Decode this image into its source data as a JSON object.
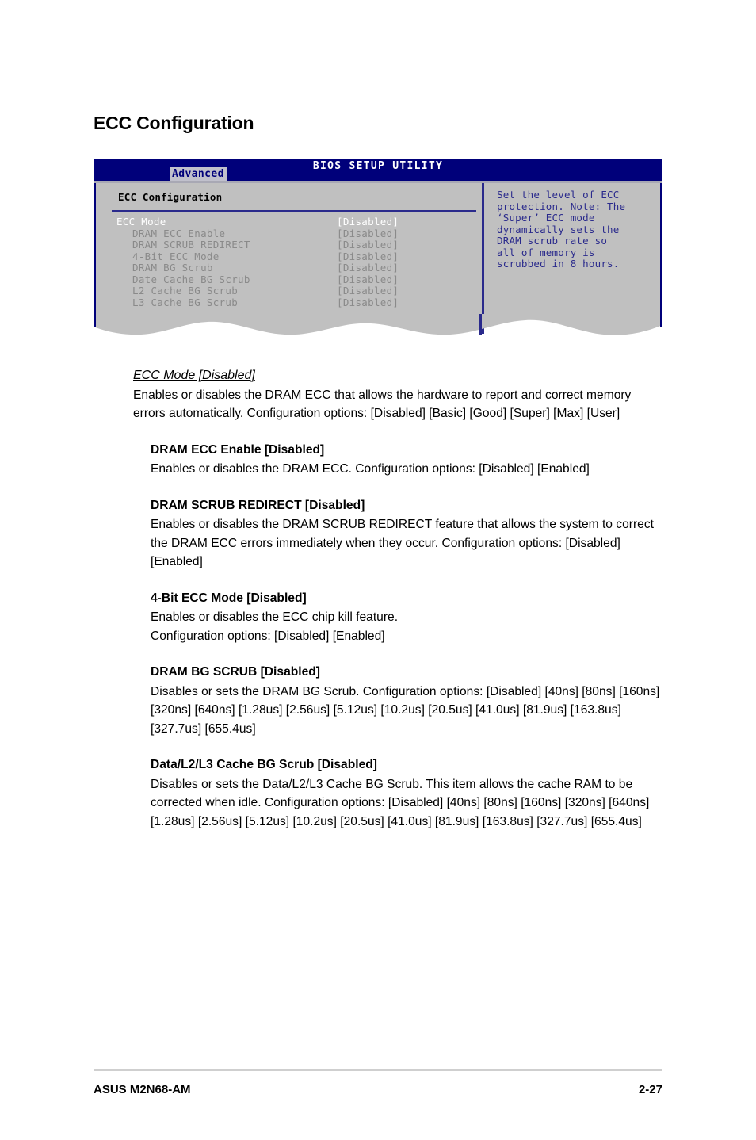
{
  "page": {
    "title": "ECC Configuration",
    "footer_left": "ASUS M2N68-AM",
    "footer_right": "2-27"
  },
  "bios": {
    "window_title": "BIOS SETUP UTILITY",
    "active_tab": "Advanced",
    "section_label": "ECC Configuration",
    "options": [
      {
        "name": "ECC Mode",
        "value": "[Disabled]",
        "state": "selected",
        "indent": false
      },
      {
        "name": "DRAM ECC Enable",
        "value": "[Disabled]",
        "state": "dim",
        "indent": true
      },
      {
        "name": "DRAM SCRUB REDIRECT",
        "value": "[Disabled]",
        "state": "dim",
        "indent": true
      },
      {
        "name": "4-Bit ECC Mode",
        "value": "[Disabled]",
        "state": "dim",
        "indent": true
      },
      {
        "name": "DRAM BG Scrub",
        "value": "[Disabled]",
        "state": "dim",
        "indent": true
      },
      {
        "name": "Date Cache BG Scrub",
        "value": "[Disabled]",
        "state": "dim",
        "indent": true
      },
      {
        "name": "L2 Cache BG Scrub",
        "value": "[Disabled]",
        "state": "dim",
        "indent": true
      },
      {
        "name": "L3 Cache BG Scrub",
        "value": "[Disabled]",
        "state": "dim",
        "indent": true
      }
    ],
    "help_text": "Set the level of ECC\nprotection. Note: The\n‘Super’ ECC mode\ndynamically sets the\nDRAM scrub rate so\nall of memory is\nscrubbed in 8 hours.",
    "colors": {
      "title_bar": "#00007a",
      "panel_bg": "#c0c0c0",
      "divider": "#2a2a8c",
      "selected_text": "#ffffff",
      "dim_text": "#8a8a8a",
      "help_text": "#2a2a8c"
    }
  },
  "content": {
    "lead": {
      "heading": "ECC Mode [Disabled]",
      "body": "Enables or disables the DRAM ECC that allows the hardware to report and correct memory errors automatically. Configuration options: [Disabled] [Basic] [Good] [Super] [Max] [User]"
    },
    "sections": [
      {
        "heading": "DRAM ECC Enable [Disabled]",
        "body": "Enables or disables the DRAM ECC. Configuration options: [Disabled] [Enabled]"
      },
      {
        "heading": "DRAM SCRUB REDIRECT [Disabled]",
        "body": "Enables or disables the DRAM SCRUB REDIRECT feature that allows the system to correct the DRAM ECC errors immediately when they occur. Configuration options: [Disabled] [Enabled]"
      },
      {
        "heading": "4-Bit ECC Mode [Disabled]",
        "body": "Enables or disables the ECC chip kill feature.\nConfiguration options: [Disabled] [Enabled]"
      },
      {
        "heading": "DRAM BG SCRUB [Disabled]",
        "body": "Disables or sets the DRAM BG Scrub. Configuration options: [Disabled] [40ns] [80ns] [160ns] [320ns] [640ns] [1.28us] [2.56us] [5.12us] [10.2us] [20.5us] [41.0us] [81.9us] [163.8us] [327.7us] [655.4us]"
      },
      {
        "heading": "Data/L2/L3 Cache BG Scrub [Disabled]",
        "body": "Disables or sets the Data/L2/L3 Cache BG Scrub. This item allows the cache RAM to be corrected when idle. Configuration options: [Disabled] [40ns] [80ns] [160ns] [320ns] [640ns] [1.28us] [2.56us] [5.12us] [10.2us] [20.5us] [41.0us] [81.9us] [163.8us] [327.7us] [655.4us]"
      }
    ]
  }
}
